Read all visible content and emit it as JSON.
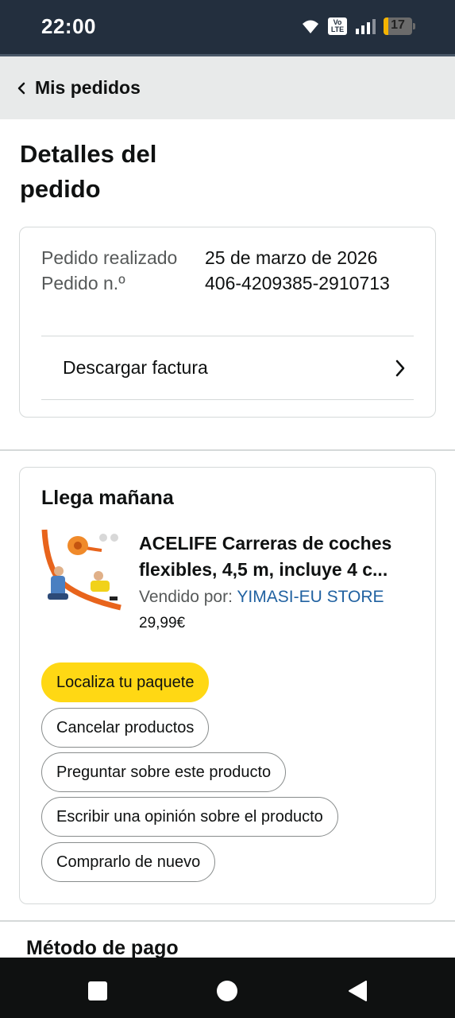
{
  "status_bar": {
    "time": "22:00",
    "volte_label": "Vo LTE",
    "battery_level": "17",
    "battery_fraction": 0.17,
    "icons": [
      "wifi-icon",
      "volte-icon",
      "signal-icon",
      "battery-icon"
    ]
  },
  "header": {
    "back_label": "Mis pedidos",
    "back_icon": "chevron-left-icon",
    "background": "#e8eaea"
  },
  "page_title": "Detalles del pedido",
  "order_info": {
    "placed_label": "Pedido realizado",
    "placed_value": "25 de marzo de 2026",
    "number_label": "Pedido n.º",
    "number_value": "406-4209385-2910713",
    "invoice_label": "Descargar factura",
    "invoice_icon": "chevron-right-icon"
  },
  "delivery": {
    "title": "Llega mañana",
    "product": {
      "name": "ACELIFE Carreras de coches flexibles, 4,5 m, incluye 4 c...",
      "seller_label": "Vendido por: ",
      "seller_name": "YIMASI-EU STORE",
      "price": "29,99€",
      "image_icon": "product-image"
    },
    "buttons": {
      "track": "Localiza tu paquete",
      "cancel": "Cancelar productos",
      "ask": "Preguntar sobre este producto",
      "review": "Escribir una opinión sobre el producto",
      "buy_again": "Comprarlo de nuevo"
    }
  },
  "payment": {
    "title": "Método de pago"
  },
  "colors": {
    "status_bar": "#232f3e",
    "primary_button": "#ffd814",
    "link": "#2162a1",
    "battery": "#f5b400"
  },
  "android_nav": {
    "icons": [
      "recents-square-icon",
      "home-circle-icon",
      "back-triangle-icon"
    ]
  }
}
